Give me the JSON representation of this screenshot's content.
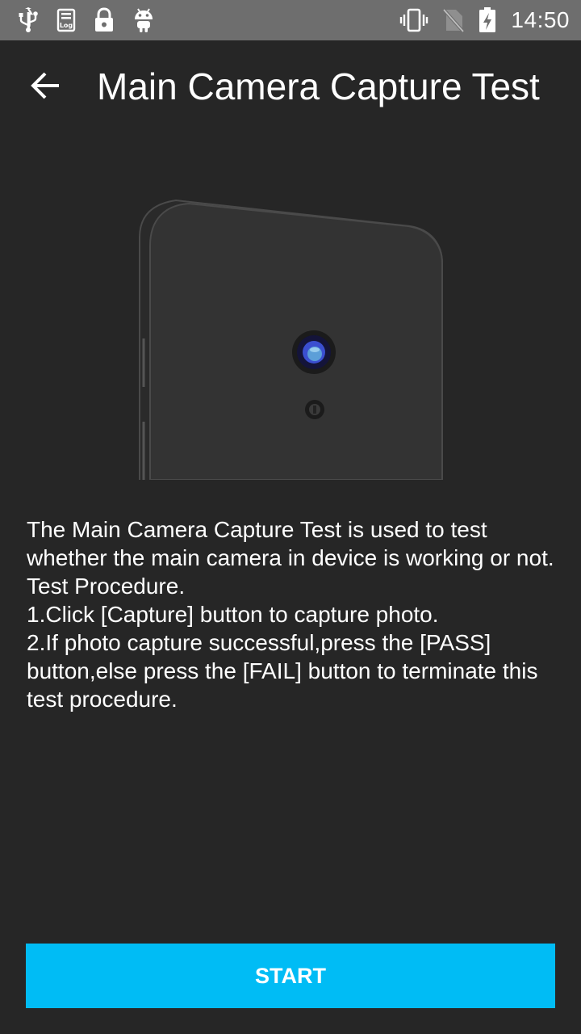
{
  "status_bar": {
    "time": "14:50",
    "left_icons": [
      "usb-icon",
      "log-icon",
      "lock-icon",
      "android-icon"
    ],
    "right_icons": [
      "vibrate-icon",
      "no-sim-icon",
      "battery-charging-icon"
    ]
  },
  "header": {
    "title": "Main Camera Capture Test",
    "back_icon": "arrow-back-icon"
  },
  "illustration": {
    "icon": "phone-back-camera-icon"
  },
  "description": {
    "lines": [
      "The Main Camera Capture Test is used to test whether the main camera in device is working or not.",
      "Test Procedure.",
      "1.Click [Capture] button to capture photo.",
      "2.If photo capture successful,press the [PASS] button,else press the [FAIL] button to terminate this test procedure."
    ]
  },
  "actions": {
    "start_label": "START"
  },
  "colors": {
    "background": "#262626",
    "status_bar": "#6e6e6e",
    "accent": "#00bcf5",
    "text": "#ffffff"
  }
}
